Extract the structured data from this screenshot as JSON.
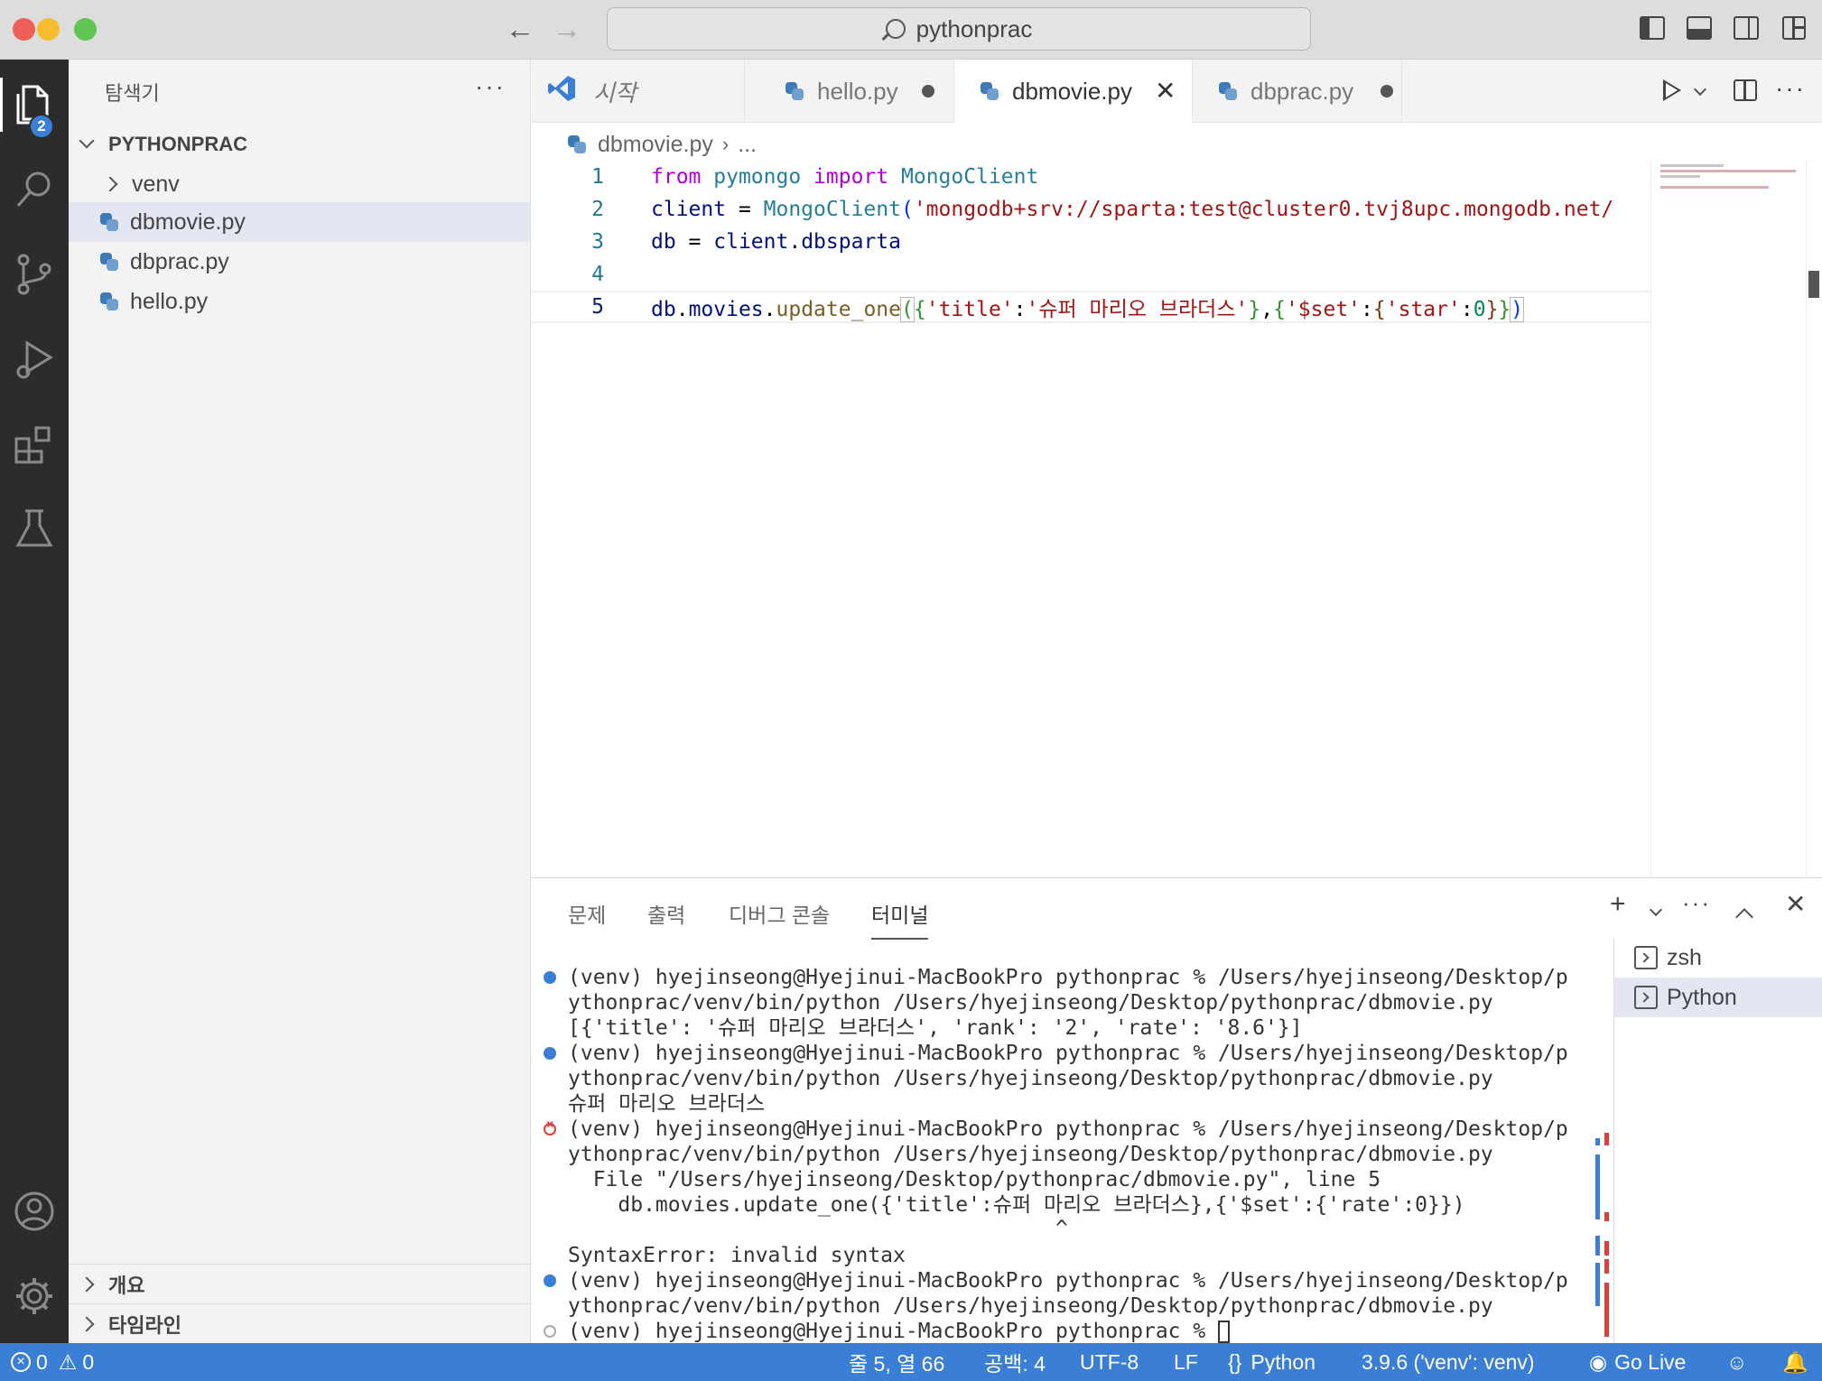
{
  "window": {
    "search_text": "pythonprac"
  },
  "activity": {
    "explorer_badge": "2"
  },
  "sidebar": {
    "title": "탐색기",
    "more": "···",
    "folder": "PYTHONPRAC",
    "items": [
      {
        "label": "venv"
      },
      {
        "label": "dbmovie.py"
      },
      {
        "label": "dbprac.py"
      },
      {
        "label": "hello.py"
      }
    ],
    "outline": "개요",
    "timeline": "타임라인"
  },
  "tabs": [
    {
      "label": "시작"
    },
    {
      "label": "hello.py"
    },
    {
      "label": "dbmovie.py"
    },
    {
      "label": "dbprac.py"
    }
  ],
  "breadcrumb": {
    "file": "dbmovie.py",
    "rest": "..."
  },
  "editor": {
    "line_numbers": [
      "1",
      "2",
      "3",
      "4",
      "5"
    ],
    "l1": {
      "kw1": "from",
      "mod1": "pymongo",
      "kw2": "import",
      "mod2": "MongoClient"
    },
    "l2": {
      "var": "client",
      "op": " = ",
      "cls": "MongoClient",
      "paren": "(",
      "str": "'mongodb+srv://sparta:test@cluster0.tvj8upc.mongodb.net/"
    },
    "l3": {
      "var1": "db",
      "op": " = ",
      "var2": "client",
      "dot": ".",
      "var3": "dbsparta"
    },
    "l5": {
      "var1": "db",
      "dot1": ".",
      "var2": "movies",
      "dot2": ".",
      "fn": "update_one",
      "p_open": "(",
      "b_open": "{",
      "s1": "'title'",
      "colon1": ":",
      "s2": "'슈퍼 마리오 브라더스'",
      "b_close": "}",
      "comma": ",",
      "b2_open": "{",
      "s3": "'$set'",
      "colon2": ":",
      "b3_open": "{",
      "s4": "'star'",
      "colon3": ":",
      "num": "0",
      "b3_close": "}",
      "b2_close": "}",
      "p_close": ")"
    }
  },
  "panel": {
    "tabs": [
      "문제",
      "출력",
      "디버그 콘솔",
      "터미널"
    ],
    "terminal_lines": [
      "(venv) hyejinseong@Hyejinui-MacBookPro pythonprac % /Users/hyejinseong/Desktop/p",
      "ythonprac/venv/bin/python /Users/hyejinseong/Desktop/pythonprac/dbmovie.py",
      "[{'title': '슈퍼 마리오 브라더스', 'rank': '2', 'rate': '8.6'}]",
      "(venv) hyejinseong@Hyejinui-MacBookPro pythonprac % /Users/hyejinseong/Desktop/p",
      "ythonprac/venv/bin/python /Users/hyejinseong/Desktop/pythonprac/dbmovie.py",
      "슈퍼 마리오 브라더스",
      "(venv) hyejinseong@Hyejinui-MacBookPro pythonprac % /Users/hyejinseong/Desktop/p",
      "ythonprac/venv/bin/python /Users/hyejinseong/Desktop/pythonprac/dbmovie.py",
      "  File \"/Users/hyejinseong/Desktop/pythonprac/dbmovie.py\", line 5",
      "    db.movies.update_one({'title':슈퍼 마리오 브라더스},{'$set':{'rate':0}})",
      "                                       ^",
      "SyntaxError: invalid syntax",
      "(venv) hyejinseong@Hyejinui-MacBookPro pythonprac % /Users/hyejinseong/Desktop/p",
      "ythonprac/venv/bin/python /Users/hyejinseong/Desktop/pythonprac/dbmovie.py",
      "(venv) hyejinseong@Hyejinui-MacBookPro pythonprac % "
    ],
    "terminals": [
      {
        "label": "zsh"
      },
      {
        "label": "Python"
      }
    ]
  },
  "status": {
    "errors": "0",
    "warnings": "0",
    "position": "줄 5, 열 66",
    "spaces": "공백: 4",
    "encoding": "UTF-8",
    "eol": "LF",
    "language": "Python",
    "interpreter": "3.9.6 ('venv': venv)",
    "golive": "Go Live"
  },
  "colors": {
    "accent": "#3a7fd5",
    "activity_bar": "#2c2c2c",
    "error": "#e03e3e"
  }
}
